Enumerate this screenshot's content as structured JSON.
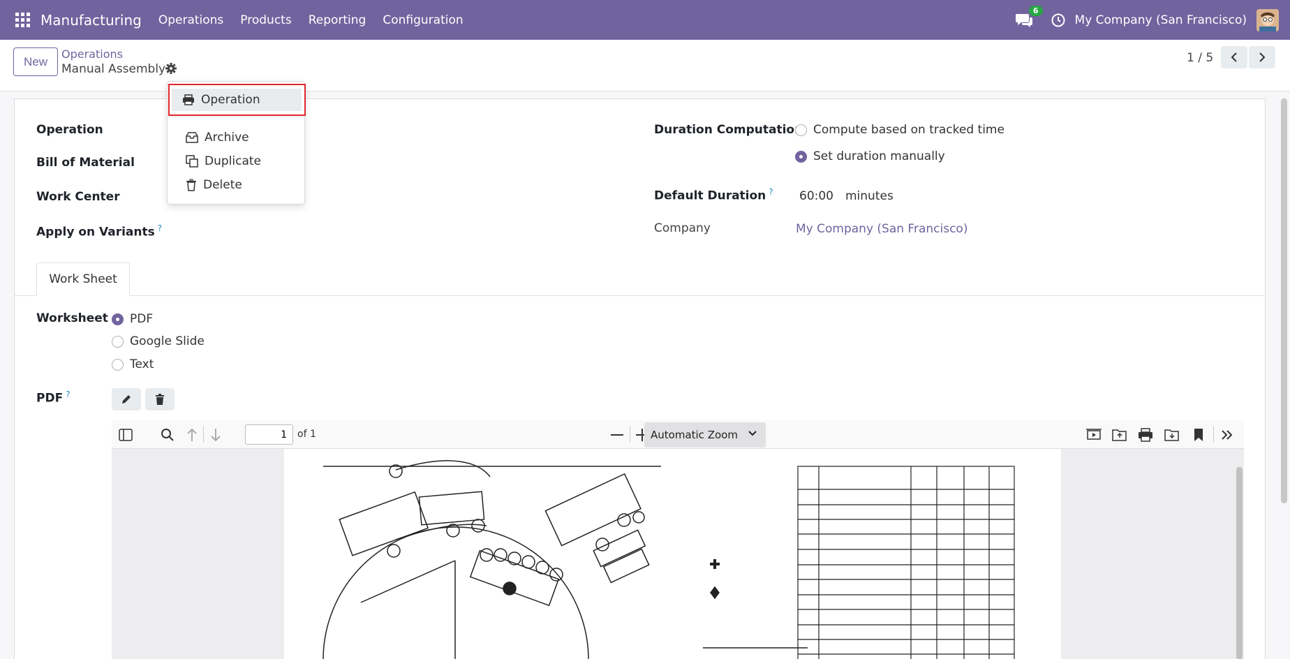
{
  "navbar": {
    "app_name": "Manufacturing",
    "menu": [
      "Operations",
      "Products",
      "Reporting",
      "Configuration"
    ],
    "chat_badge": "6",
    "company": "My Company (San Francisco)"
  },
  "control_panel": {
    "new_label": "New",
    "breadcrumb_parent": "Operations",
    "breadcrumb_current": "Manual Assembly",
    "pager": "1 / 5"
  },
  "dropdown": {
    "print_label": "Operation",
    "archive_label": "Archive",
    "duplicate_label": "Duplicate",
    "delete_label": "Delete"
  },
  "form": {
    "operation_label": "Operation",
    "bom_label": "Bill of Material",
    "work_center_label": "Work Center",
    "apply_variants_label": "Apply on Variants",
    "help_mark": "?",
    "duration_computation_label": "Duration Computation",
    "duration_options": [
      "Compute based on tracked time",
      "Set duration manually"
    ],
    "duration_selected": "Set duration manually",
    "default_duration_label": "Default Duration",
    "default_duration_value": "60:00",
    "default_duration_unit": "minutes",
    "company_label": "Company",
    "company_value": "My Company (San Francisco)"
  },
  "tabs": [
    "Work Sheet"
  ],
  "worksheet": {
    "label": "Worksheet",
    "options": [
      "PDF",
      "Google Slide",
      "Text"
    ],
    "selected": "PDF",
    "pdf_label": "PDF"
  },
  "pdf_viewer": {
    "page_value": "1",
    "page_of": "of 1",
    "zoom": "Automatic Zoom"
  },
  "colors": {
    "brand": "#71639e",
    "highlight_border": "#e0262a",
    "link": "#71639e"
  }
}
